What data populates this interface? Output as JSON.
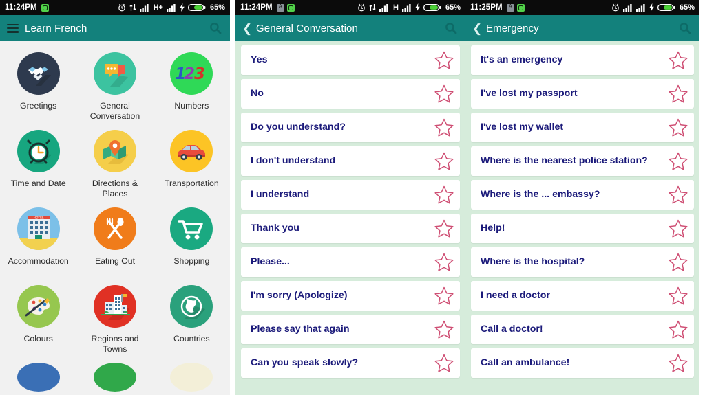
{
  "panels": [
    {
      "id": "home",
      "status": {
        "time": "11:24PM",
        "left_icons": [
          "android-chip-icon"
        ],
        "right_icons": [
          "alarm-icon",
          "data-transfer-icon",
          "signal-bars-icon",
          "network-type-label",
          "signal-bars-2-icon",
          "charging-bolt-icon",
          "battery-icon"
        ],
        "network_type": "H+",
        "battery_percent": "65%"
      },
      "appbar": {
        "menu_icon": "hamburger-icon",
        "title": "Learn French",
        "search_icon": "search-icon"
      },
      "grid": [
        {
          "label": "Greetings",
          "icon": "handshake-icon",
          "bg": "#2e3a4e"
        },
        {
          "label": "General Conversation",
          "icon": "speech-bubbles-icon",
          "bg": "#3cc3a0"
        },
        {
          "label": "Numbers",
          "icon": "numbers-123-icon",
          "bg": "#2fd957"
        },
        {
          "label": "Time and Date",
          "icon": "alarm-clock-icon",
          "bg": "#17a67f"
        },
        {
          "label": "Directions & Places",
          "icon": "map-pin-icon",
          "bg": "#f5ce4a"
        },
        {
          "label": "Transportation",
          "icon": "car-icon",
          "bg": "#fcc425"
        },
        {
          "label": "Accommodation",
          "icon": "hotel-building-icon",
          "bg": "#7cc0e8"
        },
        {
          "label": "Eating Out",
          "icon": "fork-spoon-icon",
          "bg": "#f07c1a"
        },
        {
          "label": "Shopping",
          "icon": "shopping-cart-icon",
          "bg": "#1aa981"
        },
        {
          "label": "Colours",
          "icon": "paint-palette-icon",
          "bg": "#96c74f"
        },
        {
          "label": "Regions and Towns",
          "icon": "city-buildings-icon",
          "bg": "#e03124"
        },
        {
          "label": "Countries",
          "icon": "globe-icon",
          "bg": "#2aa17c"
        }
      ],
      "grid_partial_row": [
        {
          "icon": "partial-blue-icon",
          "bg": "#3a6fb5"
        },
        {
          "icon": "partial-green-icon",
          "bg": "#30a84a"
        },
        {
          "icon": "partial-cream-icon",
          "bg": "#f3efd8"
        }
      ]
    },
    {
      "id": "general-conversation",
      "status": {
        "time": "11:24PM",
        "left_icons": [
          "app-chip-icon",
          "android-chip-icon"
        ],
        "right_icons": [
          "alarm-icon",
          "data-transfer-icon",
          "signal-bars-icon",
          "network-type-label",
          "signal-bars-2-icon",
          "charging-bolt-icon",
          "battery-icon"
        ],
        "network_type": "H",
        "battery_percent": "65%"
      },
      "appbar": {
        "back_icon": "back-chevron-icon",
        "title": "General Conversation",
        "search_icon": "search-icon"
      },
      "list": [
        {
          "phrase": "Yes",
          "favorite_icon": "star-outline-icon"
        },
        {
          "phrase": "No",
          "favorite_icon": "star-outline-icon"
        },
        {
          "phrase": "Do you understand?",
          "favorite_icon": "star-outline-icon"
        },
        {
          "phrase": "I don't understand",
          "favorite_icon": "star-outline-icon"
        },
        {
          "phrase": "I understand",
          "favorite_icon": "star-outline-icon"
        },
        {
          "phrase": "Thank you",
          "favorite_icon": "star-outline-icon"
        },
        {
          "phrase": "Please...",
          "favorite_icon": "star-outline-icon"
        },
        {
          "phrase": "I'm sorry (Apologize)",
          "favorite_icon": "star-outline-icon"
        },
        {
          "phrase": "Please say that again",
          "favorite_icon": "star-outline-icon"
        },
        {
          "phrase": "Can you speak slowly?",
          "favorite_icon": "star-outline-icon"
        }
      ]
    },
    {
      "id": "emergency",
      "status": {
        "time": "11:25PM",
        "left_icons": [
          "app-chip-icon",
          "android-chip-icon"
        ],
        "right_icons": [
          "alarm-icon",
          "signal-bars-icon",
          "signal-bars-2-icon",
          "charging-bolt-icon",
          "battery-icon"
        ],
        "network_type": "",
        "battery_percent": "65%"
      },
      "appbar": {
        "back_icon": "back-chevron-icon",
        "title": "Emergency",
        "search_icon": "search-icon"
      },
      "list": [
        {
          "phrase": "It's an emergency",
          "favorite_icon": "star-outline-icon"
        },
        {
          "phrase": "I've lost my passport",
          "favorite_icon": "star-outline-icon"
        },
        {
          "phrase": "I've lost my wallet",
          "favorite_icon": "star-outline-icon"
        },
        {
          "phrase": "Where is the nearest police station?",
          "favorite_icon": "star-outline-icon"
        },
        {
          "phrase": "Where is the ... embassy?",
          "favorite_icon": "star-outline-icon"
        },
        {
          "phrase": "Help!",
          "favorite_icon": "star-outline-icon"
        },
        {
          "phrase": "Where is the hospital?",
          "favorite_icon": "star-outline-icon"
        },
        {
          "phrase": "I need a doctor",
          "favorite_icon": "star-outline-icon"
        },
        {
          "phrase": "Call a doctor!",
          "favorite_icon": "star-outline-icon"
        },
        {
          "phrase": "Call an ambulance!",
          "favorite_icon": "star-outline-icon"
        }
      ]
    }
  ],
  "colors": {
    "appbar": "#13817c",
    "statusbar": "#0b0b0b",
    "list_background": "#d6ecdb",
    "card": "#ffffff",
    "phrase_text": "#1b1a7a",
    "star_outline": "#cf4f74",
    "grid_background": "#f1f1f1",
    "battery_fill": "#4cd137"
  }
}
